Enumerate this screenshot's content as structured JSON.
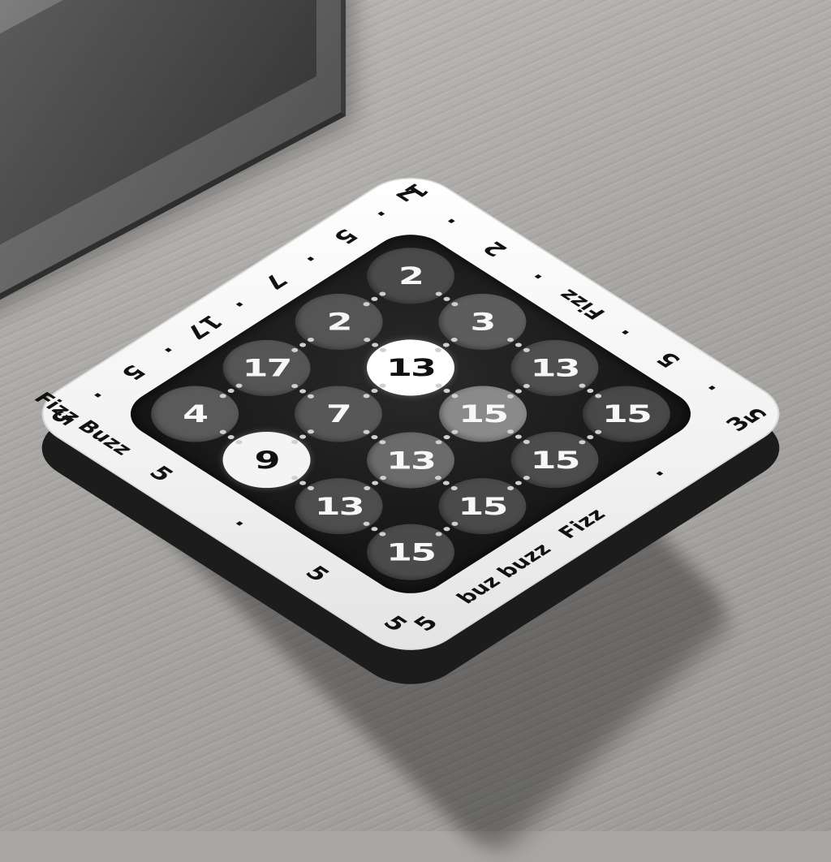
{
  "background": {
    "desk_color": "#a9a7a4",
    "board_color": "#ffffff",
    "grid_color": "#151515"
  },
  "grid": {
    "rows": [
      [
        {
          "label": "2",
          "tone": "#4a4a4a"
        },
        {
          "label": "3",
          "tone": "#5d5d5d"
        },
        {
          "label": "13",
          "tone": "#4f4f4f"
        },
        {
          "label": "15",
          "tone": "#484848"
        }
      ],
      [
        {
          "label": "2",
          "tone": "#555555"
        },
        {
          "label": "13",
          "tone": "#ffffff"
        },
        {
          "label": "15",
          "tone": "#8a8a8a"
        },
        {
          "label": "15",
          "tone": "#4c4c4c"
        }
      ],
      [
        {
          "label": "17",
          "tone": "#555555"
        },
        {
          "label": "7",
          "tone": "#575757"
        },
        {
          "label": "13",
          "tone": "#6b6b6b"
        },
        {
          "label": "15",
          "tone": "#4a4a4a"
        }
      ],
      [
        {
          "label": "4",
          "tone": "#5a5a5a"
        },
        {
          "label": "9",
          "tone": "#f4f4f4"
        },
        {
          "label": "13",
          "tone": "#4d4d4d"
        },
        {
          "label": "15",
          "tone": "#4b4b4b"
        }
      ]
    ]
  },
  "border": {
    "top_right": [
      "3",
      "·",
      "Fizz",
      "buz buzz",
      "5"
    ],
    "top_left": [
      "5",
      "·",
      "5",
      "·",
      "Fizz",
      "·",
      "2",
      "·",
      "7"
    ],
    "bottom_left": [
      "1",
      "·",
      "5",
      "·",
      "7",
      "·",
      "17",
      "·",
      "5",
      "·",
      "5"
    ],
    "bottom_right": [
      "Fizz Buzz",
      "5",
      "·",
      "5",
      "5"
    ]
  }
}
